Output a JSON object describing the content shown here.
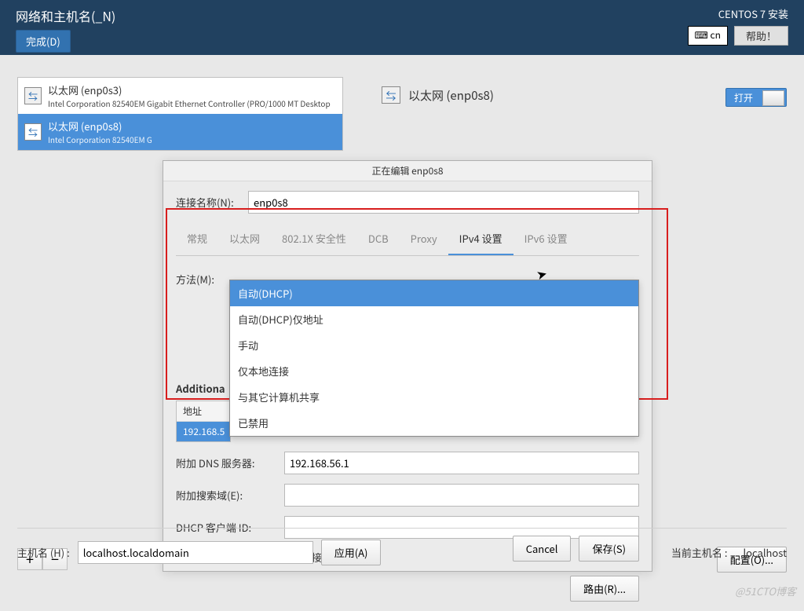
{
  "header": {
    "title": "网络和主机名(_N)",
    "done": "完成(D)",
    "install_title": "CENTOS 7 安装",
    "lang": "cn",
    "help": "帮助！"
  },
  "nics": [
    {
      "name": "以太网 (enp0s3)",
      "desc": "Intel Corporation 82540EM Gigabit Ethernet Controller (PRO/1000 MT Desktop"
    },
    {
      "name": "以太网 (enp0s8)",
      "desc": "Intel Corporation 82540EM G"
    }
  ],
  "right": {
    "title": "以太网 (enp0s8)",
    "toggle": "打开",
    "configure": "配置(O)..."
  },
  "dialog": {
    "title": "正在编辑 enp0s8",
    "conn_label": "连接名称(N):",
    "conn_value": "enp0s8",
    "tabs": [
      "常规",
      "以太网",
      "802.1X 安全性",
      "DCB",
      "Proxy",
      "IPv4 设置",
      "IPv6 设置"
    ],
    "method_label": "方法(M):",
    "method_options": [
      "自动(DHCP)",
      "自动(DHCP)仅地址",
      "手动",
      "仅本地连接",
      "与其它计算机共享",
      "已禁用"
    ],
    "additional": "Additiona",
    "addr_header": "地址",
    "addr_value": "192.168.5",
    "dns_label": "附加 DNS 服务器:",
    "dns_value": "192.168.56.1",
    "search_label": "附加搜索域(E):",
    "dhcp_label": "DHCP 客户端 ID:",
    "require_label": "需要 IPv4 地址完成这个连接",
    "route": "路由(R)...",
    "cancel": "Cancel",
    "save": "保存(S)"
  },
  "hostname": {
    "label": "主机名 (H) :",
    "value": "localhost.localdomain",
    "apply": "应用(A)",
    "current_label": "当前主机名 :",
    "current_value": "localhost"
  },
  "watermark": "@51CTO博客"
}
